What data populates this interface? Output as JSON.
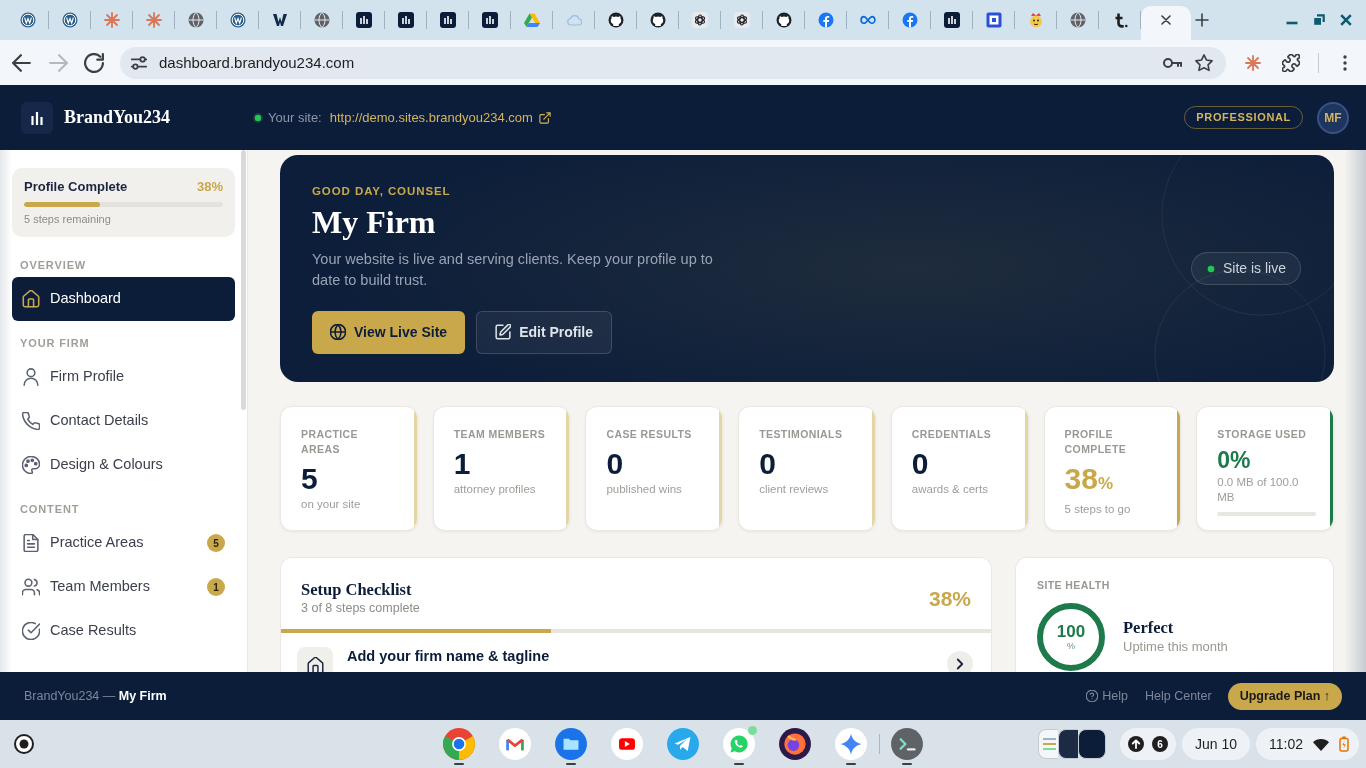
{
  "browser": {
    "tabs": [
      {
        "kind": "wp",
        "selected": false
      },
      {
        "kind": "wp",
        "selected": false
      },
      {
        "kind": "asterisk",
        "selected": false
      },
      {
        "kind": "asterisk",
        "selected": false
      },
      {
        "kind": "globe",
        "selected": false
      },
      {
        "kind": "wp",
        "selected": false
      },
      {
        "kind": "wmark",
        "selected": false
      },
      {
        "kind": "globe",
        "selected": false
      },
      {
        "kind": "bars",
        "selected": false
      },
      {
        "kind": "bars",
        "selected": false
      },
      {
        "kind": "bars",
        "selected": false
      },
      {
        "kind": "bars",
        "selected": false
      },
      {
        "kind": "drive",
        "selected": false
      },
      {
        "kind": "cloud",
        "selected": false
      },
      {
        "kind": "cat",
        "selected": false
      },
      {
        "kind": "cat",
        "selected": false
      },
      {
        "kind": "knot",
        "selected": false
      },
      {
        "kind": "knot",
        "selected": false
      },
      {
        "kind": "cat",
        "selected": false
      },
      {
        "kind": "fcircle",
        "selected": false
      },
      {
        "kind": "infinity",
        "selected": false
      },
      {
        "kind": "fcircle",
        "selected": false
      },
      {
        "kind": "bars",
        "selected": false
      },
      {
        "kind": "square",
        "selected": false
      },
      {
        "kind": "mascot",
        "selected": false
      },
      {
        "kind": "globe",
        "selected": false
      },
      {
        "kind": "tmark",
        "selected": false
      },
      {
        "selected": true
      }
    ],
    "nav": [
      {
        "kind": "back",
        "disabled": false
      },
      {
        "kind": "forward",
        "disabled": true
      },
      {
        "kind": "reload",
        "disabled": false
      }
    ],
    "url": "dashboard.brandyou234.com"
  },
  "header": {
    "brand": "BrandYou234",
    "site_label": "Your site:",
    "site_url": "http://demo.sites.brandyou234.com",
    "plan": "PROFESSIONAL",
    "avatar": "MF"
  },
  "sidebar": {
    "progress": {
      "title": "Profile Complete",
      "value": "38%",
      "level": 0.38,
      "note": "5 steps remaining"
    },
    "sections": [
      {
        "title": "OVERVIEW",
        "items": [
          {
            "kind": "home",
            "label": "Dashboard",
            "selected": true
          }
        ]
      },
      {
        "title": "YOUR FIRM",
        "items": [
          {
            "kind": "user",
            "label": "Firm Profile",
            "selected": false
          },
          {
            "kind": "phone",
            "label": "Contact Details",
            "selected": false
          },
          {
            "kind": "palette",
            "label": "Design & Colours",
            "selected": false
          }
        ]
      },
      {
        "title": "CONTENT",
        "items": [
          {
            "kind": "document",
            "label": "Practice Areas",
            "selected": false,
            "badge": "5"
          },
          {
            "kind": "users",
            "label": "Team Members",
            "selected": false,
            "badge": "1"
          },
          {
            "kind": "check",
            "label": "Case Results",
            "selected": false
          }
        ]
      }
    ]
  },
  "hero": {
    "eyebrow": "GOOD DAY, COUNSEL",
    "title": "My Firm",
    "text": "Your website is live and serving clients. Keep your profile up to date to build trust.",
    "buttons": [
      {
        "kind": "globe",
        "label": "View Live Site",
        "primary": true
      },
      {
        "kind": "edit",
        "label": "Edit Profile",
        "primary": false
      }
    ],
    "status": "Site is live"
  },
  "stats": [
    {
      "kind": "count",
      "label": "PRACTICE AREAS",
      "value": "5",
      "note": "on your site",
      "color": "#e4d5a4"
    },
    {
      "kind": "count",
      "label": "TEAM MEMBERS",
      "value": "1",
      "note": "attorney profiles",
      "color": "#e4d5a4"
    },
    {
      "kind": "count",
      "label": "CASE RESULTS",
      "value": "0",
      "note": "published wins",
      "color": "#e4d5a4"
    },
    {
      "kind": "count",
      "label": "TESTIMONIALS",
      "value": "0",
      "note": "client reviews",
      "color": "#e4d5a4"
    },
    {
      "kind": "count",
      "label": "CREDENTIALS",
      "value": "0",
      "note": "awards & certs",
      "color": "#e4d5a4"
    },
    {
      "kind": "percent",
      "label": "PROFILE COMPLETE",
      "value": "38",
      "unit": "%",
      "note": "5 steps to go",
      "color": "#c9a84c"
    },
    {
      "kind": "storage",
      "label": "STORAGE USED",
      "value": "0%",
      "note": "0.0 MB of 100.0 MB",
      "color": "#1e7a4a"
    }
  ],
  "checklist": {
    "title": "Setup Checklist",
    "note": "3 of 8 steps complete",
    "value": "38%",
    "level": 0.38,
    "steps": [
      {
        "kind": "home",
        "label": "Add your firm name & tagline"
      }
    ]
  },
  "health": {
    "title": "SITE HEALTH",
    "value": "100",
    "unit": "%",
    "status": "Perfect",
    "note": "Uptime this month"
  },
  "footer": {
    "text": "BrandYou234 — **My Firm**",
    "links": [
      {
        "kind": "help",
        "label": "Help"
      },
      {
        "label": "Help Center"
      }
    ],
    "button": "Upgrade Plan ↑"
  },
  "shelf": {
    "apps": [
      {
        "kind": "chrome",
        "running": true,
        "notification": false
      },
      {
        "kind": "gmail",
        "running": false,
        "notification": false
      },
      {
        "kind": "files",
        "running": true,
        "notification": false
      },
      {
        "kind": "youtube",
        "running": false,
        "notification": false
      },
      {
        "kind": "telegram",
        "running": false,
        "notification": false
      },
      {
        "kind": "whatsapp",
        "running": true,
        "notification": true
      },
      {
        "kind": "firefox",
        "running": false,
        "notification": false
      },
      {
        "kind": "sparkle",
        "running": true,
        "notification": false
      },
      {
        "kind": "terminal",
        "running": true,
        "notification": false
      }
    ],
    "count": "6",
    "date": "Jun 10",
    "time": "11:02"
  }
}
